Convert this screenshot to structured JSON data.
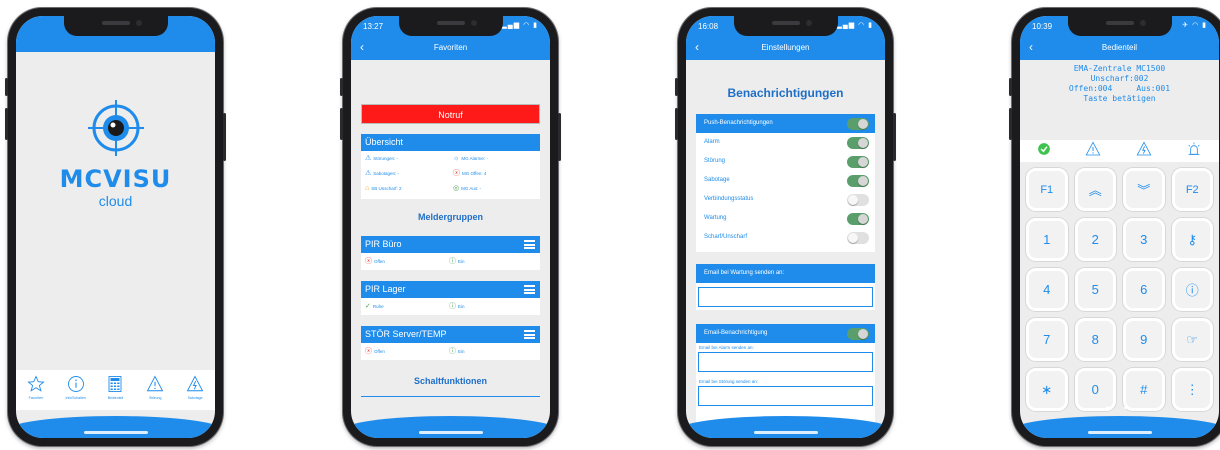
{
  "phone1": {
    "logo_title": "MCVISU",
    "logo_sub": "cloud",
    "tabs": [
      {
        "label": "Favoriten",
        "icon": "star-icon"
      },
      {
        "label": "Info/Schalten",
        "icon": "info-icon"
      },
      {
        "label": "Bedienteil",
        "icon": "keypad-icon"
      },
      {
        "label": "Störung",
        "icon": "warning-icon"
      },
      {
        "label": "Sabotage",
        "icon": "sabotage-icon"
      }
    ]
  },
  "phone2": {
    "time": "13:27",
    "title": "Favoriten",
    "notruf": "Notruf",
    "overview": {
      "header": "Übersicht",
      "items": [
        "Störungen: -",
        "MG Alarme: -",
        "Sabotagen: -",
        "MG Offen: 4",
        "SB Unscharf: 2",
        "MG Aus: -"
      ]
    },
    "groups_title": "Meldergruppen",
    "groups": [
      {
        "name": "PIR Büro",
        "state": "Offen",
        "mode": "Ein"
      },
      {
        "name": "PIR Lager",
        "state": "Ruhe",
        "mode": "Ein"
      },
      {
        "name": "STÖR Server/TEMP",
        "state": "Offen",
        "mode": "Ein"
      }
    ],
    "functions_title": "Schaltfunktionen"
  },
  "phone3": {
    "time": "16:08",
    "title": "Einstellungen",
    "heading": "Benachrichtigungen",
    "push_header": "Push-Benachrichtigungen",
    "toggles": [
      {
        "label": "Alarm",
        "on": true
      },
      {
        "label": "Störung",
        "on": true
      },
      {
        "label": "Sabotage",
        "on": true
      },
      {
        "label": "Verbindungsstatus",
        "on": false
      },
      {
        "label": "Wartung",
        "on": true
      },
      {
        "label": "Scharf/Unscharf",
        "on": false
      }
    ],
    "wartung_header": "Email bei Wartung senden an:",
    "email_header": "Email-Benachrichtigung",
    "alarm_label": "Email bei Alarm senden an:",
    "stoerung_label": "Email bei Störung senden an:"
  },
  "phone4": {
    "time": "10:39",
    "title": "Bedienteil",
    "lcd": [
      "EMA-Zentrale MC1500",
      "Unscharf:002",
      "Offen:004     Aus:001",
      "Taste betätigen"
    ],
    "keys": [
      "F1",
      "︽",
      "︾",
      "F2",
      "1",
      "2",
      "3",
      "⚷",
      "4",
      "5",
      "6",
      "ⓘ",
      "7",
      "8",
      "9",
      "☞",
      "∗",
      "0",
      "#",
      "⋮"
    ]
  },
  "colors": {
    "accent": "#1f8ceb",
    "notruf": "#ff1a1a",
    "toggle_on": "#5a9f6b"
  }
}
